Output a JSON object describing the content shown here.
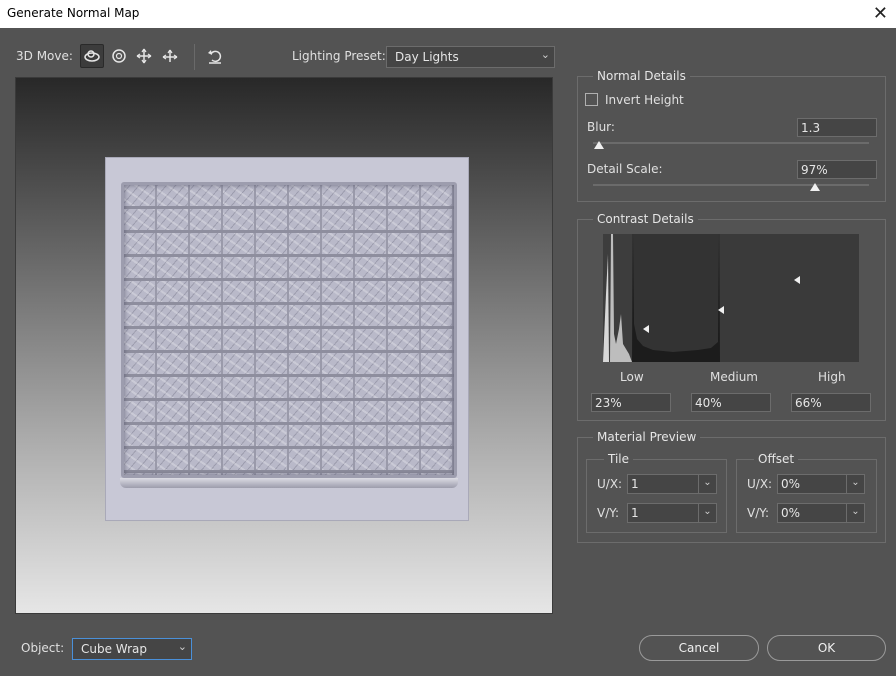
{
  "window": {
    "title": "Generate Normal Map",
    "close_icon": "close-icon"
  },
  "toolbar": {
    "move_label": "3D Move:",
    "tools": [
      "rotate-3d-icon",
      "roll-icon",
      "pan-icon",
      "slide-icon"
    ],
    "reset_icon": "reset-icon",
    "lighting_label": "Lighting Preset:",
    "lighting_value": "Day Lights"
  },
  "normal_details": {
    "title": "Normal Details",
    "invert_label": "Invert Height",
    "invert_checked": false,
    "blur_label": "Blur:",
    "blur_value": "1.3",
    "detail_label": "Detail Scale:",
    "detail_value": "97%"
  },
  "contrast_details": {
    "title": "Contrast Details",
    "low_label": "Low",
    "medium_label": "Medium",
    "high_label": "High",
    "low_value": "23%",
    "medium_value": "40%",
    "high_value": "66%"
  },
  "material_preview": {
    "title": "Material Preview",
    "tile_title": "Tile",
    "offset_title": "Offset",
    "ux_label": "U/X:",
    "vy_label": "V/Y:",
    "tile_ux": "1",
    "tile_vy": "1",
    "offset_ux": "0%",
    "offset_vy": "0%"
  },
  "footer": {
    "object_label": "Object:",
    "object_value": "Cube Wrap",
    "cancel_label": "Cancel",
    "ok_label": "OK"
  }
}
